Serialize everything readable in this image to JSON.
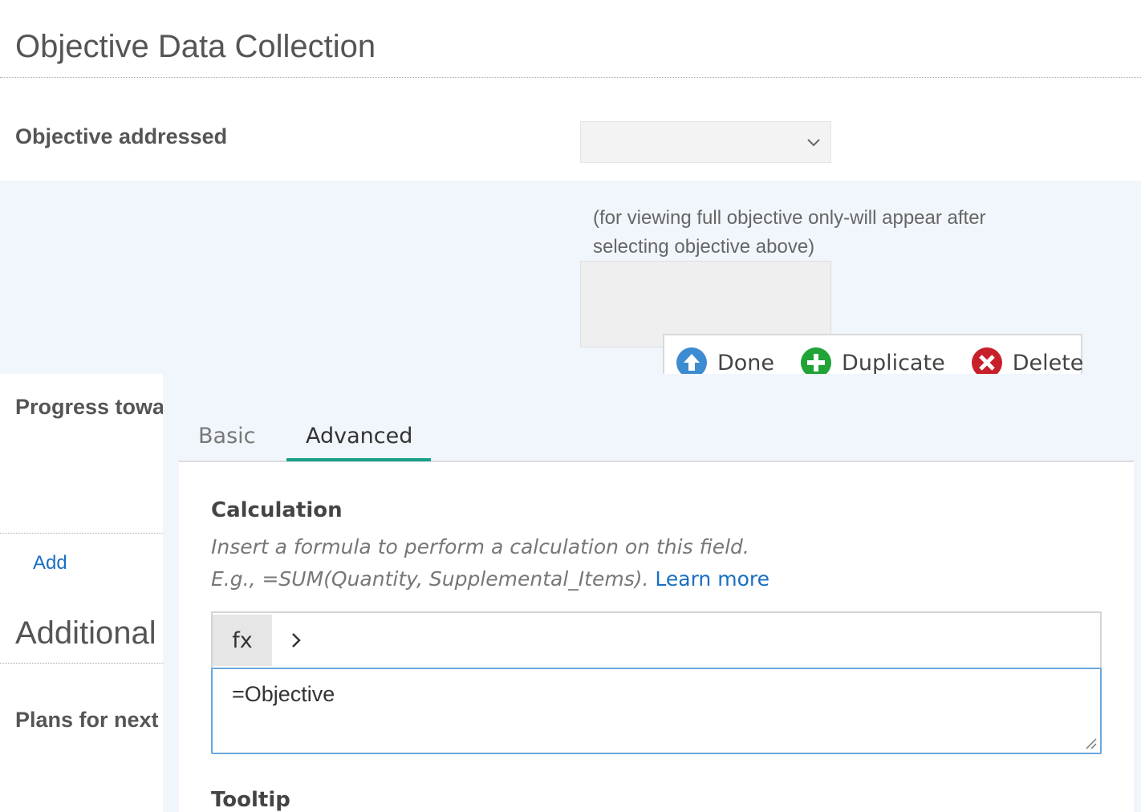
{
  "page": {
    "section_title": "Objective Data Collection",
    "section_title_2": "Additional"
  },
  "fields": {
    "objective_label": "Objective addressed",
    "objective_select_value": "",
    "objective_hint_1": "(for viewing full objective only-will appear after",
    "objective_hint_2": "selecting objective above)",
    "progress_label": "Progress towa",
    "add_link": "Add",
    "plans_label": "Plans for next"
  },
  "toolbar": {
    "done": "Done",
    "duplicate": "Duplicate",
    "delete": "Delete",
    "colors": {
      "done": "#3d8bd0",
      "duplicate": "#21a336",
      "delete": "#c8202a"
    }
  },
  "panel": {
    "tabs": [
      {
        "label": "Basic",
        "active": false
      },
      {
        "label": "Advanced",
        "active": true
      }
    ],
    "calculation": {
      "heading": "Calculation",
      "desc_1": "Insert a formula to perform a calculation on this field.",
      "desc_2": "E.g., =SUM(Quantity, Supplemental_Items).",
      "learn_more": "Learn more",
      "fx_label": "fx",
      "formula_value": "=Objective"
    },
    "tooltip_heading": "Tooltip"
  },
  "colors": {
    "accent": "#1aa08c",
    "link": "#1a6fc2",
    "band_bg": "#f1f6fd"
  }
}
